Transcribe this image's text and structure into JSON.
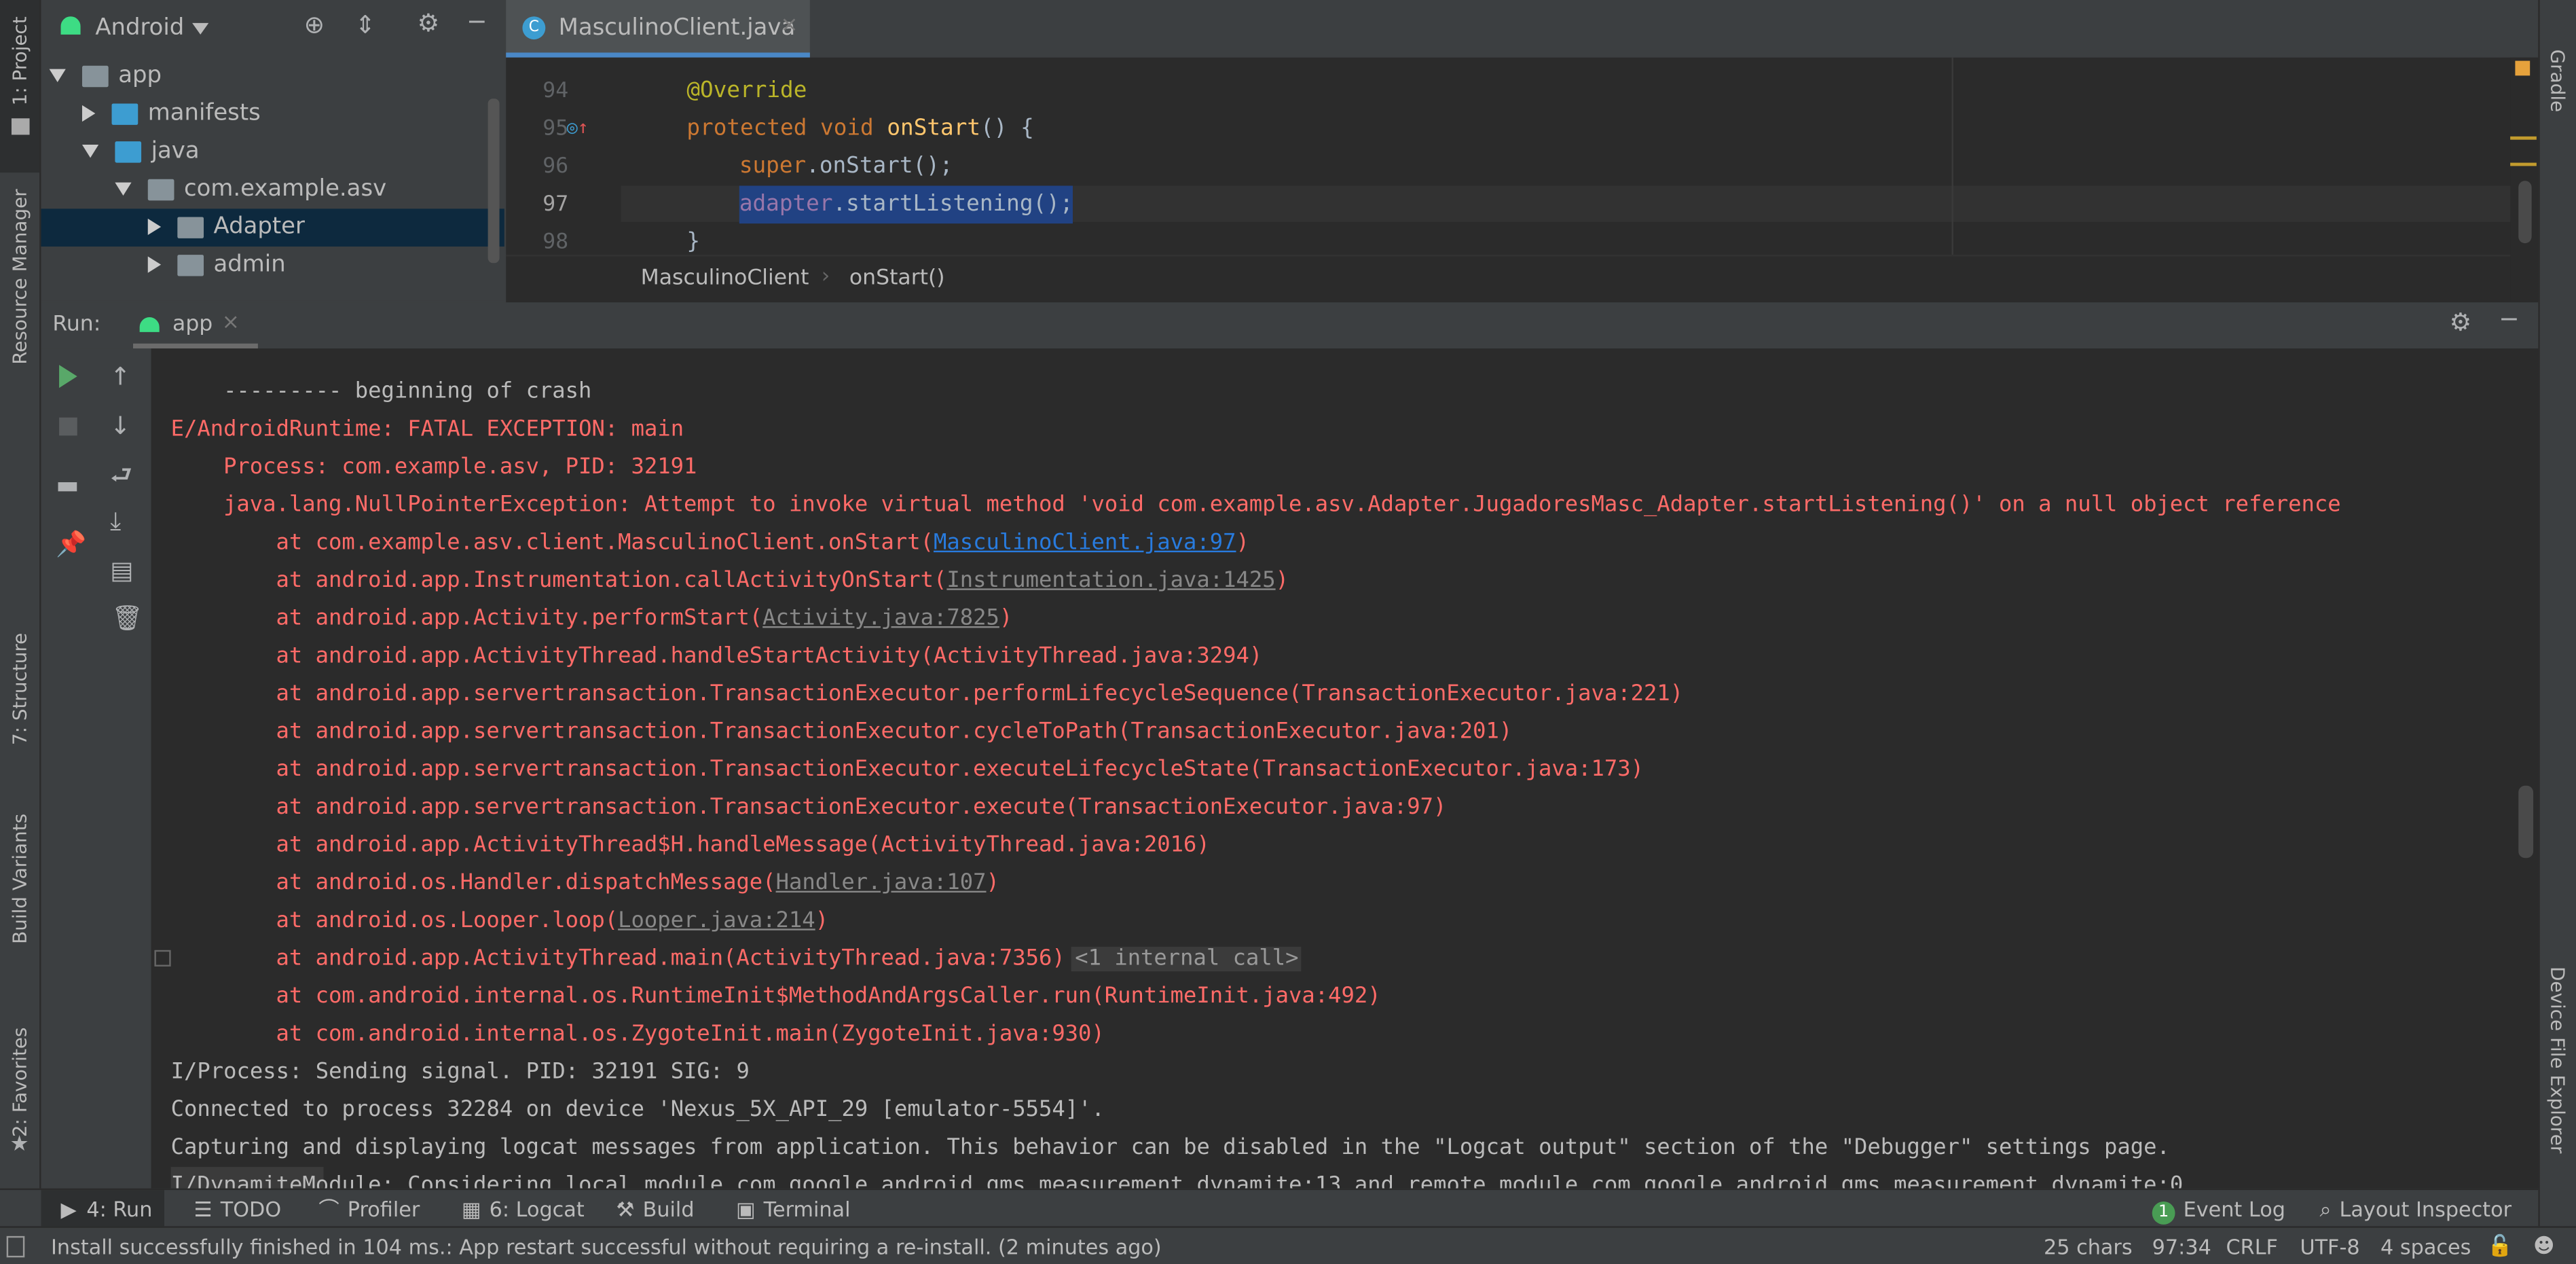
{
  "left_strip": {
    "project": "1: Project",
    "resource_manager": "Resource Manager",
    "structure": "7: Structure",
    "build_variants": "Build Variants",
    "favorites": "2: Favorites"
  },
  "right_strip": {
    "gradle": "Gradle",
    "device_file_explorer": "Device File Explorer"
  },
  "project_panel": {
    "view_selector": "Android",
    "tree": [
      {
        "label": "app",
        "expanded": true,
        "depth": 0
      },
      {
        "label": "manifests",
        "expanded": false,
        "depth": 1
      },
      {
        "label": "java",
        "expanded": true,
        "depth": 1
      },
      {
        "label": "com.example.asv",
        "expanded": true,
        "depth": 2
      },
      {
        "label": "Adapter",
        "expanded": false,
        "depth": 3,
        "selected": true
      },
      {
        "label": "admin",
        "expanded": false,
        "depth": 3
      }
    ]
  },
  "editor": {
    "tab": "MasculinoClient.java",
    "lines": [
      {
        "num": "94",
        "text": "@Override"
      },
      {
        "num": "95",
        "kw": "protected void ",
        "fn": "onStart",
        "rest": "() {"
      },
      {
        "num": "96",
        "kw": "super",
        "rest": ".onStart();"
      },
      {
        "num": "97",
        "field": "adapter",
        "rest": ".startListening();"
      },
      {
        "num": "98",
        "text": "}"
      }
    ],
    "breadcrumb": [
      "MasculinoClient",
      "onStart()"
    ]
  },
  "run_panel": {
    "label": "Run:",
    "tab": "app",
    "console": [
      {
        "indent": 1,
        "text": "--------- beginning of crash",
        "color": "normal"
      },
      {
        "indent": 0,
        "text": "E/AndroidRuntime: FATAL EXCEPTION: main",
        "color": "red"
      },
      {
        "indent": 1,
        "text": "Process: com.example.asv, PID: 32191",
        "color": "red"
      },
      {
        "indent": 1,
        "text": "java.lang.NullPointerException: Attempt to invoke virtual method 'void com.example.asv.Adapter.JugadoresMasc_Adapter.startListening()' on a null object reference",
        "color": "red"
      },
      {
        "indent": 2,
        "pre": "at com.example.asv.client.MasculinoClient.onStart(",
        "link": "MasculinoClient.java:97",
        "link_style": "blue",
        "post": ")",
        "color": "red"
      },
      {
        "indent": 2,
        "pre": "at android.app.Instrumentation.callActivityOnStart(",
        "link": "Instrumentation.java:1425",
        "link_style": "gray",
        "post": ")",
        "color": "red"
      },
      {
        "indent": 2,
        "pre": "at android.app.Activity.performStart(",
        "link": "Activity.java:7825",
        "link_style": "gray",
        "post": ")",
        "color": "red"
      },
      {
        "indent": 2,
        "text": "at android.app.ActivityThread.handleStartActivity(ActivityThread.java:3294)",
        "color": "red"
      },
      {
        "indent": 2,
        "text": "at android.app.servertransaction.TransactionExecutor.performLifecycleSequence(TransactionExecutor.java:221)",
        "color": "red"
      },
      {
        "indent": 2,
        "text": "at android.app.servertransaction.TransactionExecutor.cycleToPath(TransactionExecutor.java:201)",
        "color": "red"
      },
      {
        "indent": 2,
        "text": "at android.app.servertransaction.TransactionExecutor.executeLifecycleState(TransactionExecutor.java:173)",
        "color": "red"
      },
      {
        "indent": 2,
        "text": "at android.app.servertransaction.TransactionExecutor.execute(TransactionExecutor.java:97)",
        "color": "red"
      },
      {
        "indent": 2,
        "text": "at android.app.ActivityThread$H.handleMessage(ActivityThread.java:2016)",
        "color": "red"
      },
      {
        "indent": 2,
        "pre": "at android.os.Handler.dispatchMessage(",
        "link": "Handler.java:107",
        "link_style": "gray",
        "post": ")",
        "color": "red"
      },
      {
        "indent": 2,
        "pre": "at android.os.Looper.loop(",
        "link": "Looper.java:214",
        "link_style": "gray",
        "post": ")",
        "color": "red"
      },
      {
        "indent": 2,
        "text": "at android.app.ActivityThread.main(ActivityThread.java:7356)",
        "fold": "<1 internal call>",
        "color": "red"
      },
      {
        "indent": 2,
        "text": "at com.android.internal.os.RuntimeInit$MethodAndArgsCaller.run(RuntimeInit.java:492)",
        "color": "red"
      },
      {
        "indent": 2,
        "text": "at com.android.internal.os.ZygoteInit.main(ZygoteInit.java:930)",
        "color": "red"
      },
      {
        "indent": 0,
        "text": "I/Process: Sending signal. PID: 32191 SIG: 9",
        "color": "normal"
      },
      {
        "indent": 0,
        "text": "Connected to process 32284 on device 'Nexus_5X_API_29 [emulator-5554]'.",
        "color": "normal"
      },
      {
        "indent": 0,
        "text": "Capturing and displaying logcat messages from application. This behavior can be disabled in the \"Logcat output\" section of the \"Debugger\" settings page.",
        "color": "normal"
      },
      {
        "indent": 0,
        "text": "I/DynamiteModule: Considering local module com.google.android.gms.measurement.dynamite:13 and remote module com.google.android.gms.measurement.dynamite:0",
        "color": "normal"
      }
    ]
  },
  "bottom_tabs": [
    {
      "label": "4: Run",
      "icon": "play-icon",
      "active": true
    },
    {
      "label": "TODO",
      "icon": "list-icon"
    },
    {
      "label": "Profiler",
      "icon": "profiler-icon"
    },
    {
      "label": "6: Logcat",
      "icon": "logcat-icon"
    },
    {
      "label": "Build",
      "icon": "hammer-icon"
    },
    {
      "label": "Terminal",
      "icon": "terminal-icon"
    }
  ],
  "bottom_right_tabs": [
    {
      "label": "Event Log",
      "badge": "1"
    },
    {
      "label": "Layout Inspector"
    }
  ],
  "status_bar": {
    "message": "Install successfully finished in 104 ms.: App restart successful without requiring a re-install. (2 minutes ago)",
    "chars": "25 chars",
    "position": "97:34",
    "line_sep": "CRLF",
    "encoding": "UTF-8",
    "indent": "4 spaces"
  },
  "colors": {
    "error": "#ff6b68",
    "link": "#287bde",
    "selection": "#214283",
    "android_green": "#3ddc84"
  }
}
